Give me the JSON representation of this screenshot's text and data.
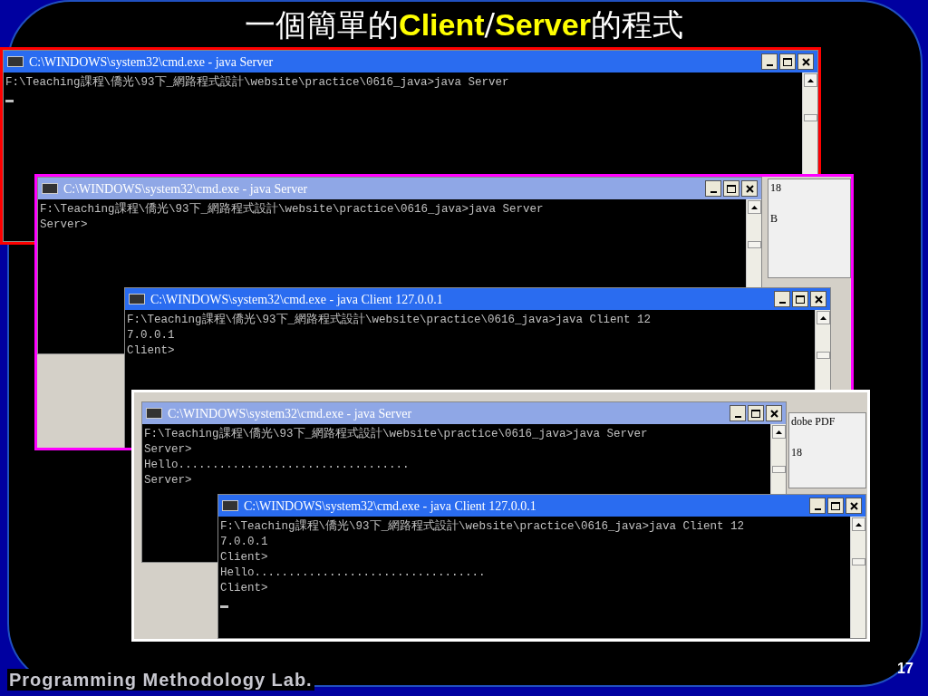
{
  "title_parts": [
    {
      "text": "一個簡單的",
      "kind": "plain"
    },
    {
      "text": "Client",
      "kind": "emph"
    },
    {
      "text": "/",
      "kind": "plain"
    },
    {
      "text": "Server",
      "kind": "emph"
    },
    {
      "text": "的程式",
      "kind": "plain"
    }
  ],
  "screenshots": [
    {
      "color": "#ff0000",
      "windows": [
        {
          "title": "C:\\WINDOWS\\system32\\cmd.exe - java Server",
          "active": true,
          "lines": [
            "F:\\Teaching課程\\僑光\\93下_網路程式設計\\website\\practice\\0616_java>java Server"
          ],
          "cursor": true
        }
      ]
    },
    {
      "color": "#ff00ff",
      "fragments": [
        "18",
        "B"
      ],
      "windows": [
        {
          "title": "C:\\WINDOWS\\system32\\cmd.exe - java Server",
          "active": false,
          "lines": [
            "F:\\Teaching課程\\僑光\\93下_網路程式設計\\website\\practice\\0616_java>java Server",
            "Server>"
          ],
          "cursor": false
        },
        {
          "title": "C:\\WINDOWS\\system32\\cmd.exe - java Client 127.0.0.1",
          "active": true,
          "lines": [
            "F:\\Teaching課程\\僑光\\93下_網路程式設計\\website\\practice\\0616_java>java Client 12",
            "7.0.0.1",
            "Client>"
          ],
          "cursor": false
        }
      ]
    },
    {
      "color": "#ffffff",
      "fragments": [
        "dobe PDF",
        "18"
      ],
      "windows": [
        {
          "title": "C:\\WINDOWS\\system32\\cmd.exe - java Server",
          "active": false,
          "lines": [
            "F:\\Teaching課程\\僑光\\93下_網路程式設計\\website\\practice\\0616_java>java Server",
            "Server>",
            "Hello..................................",
            "Server>"
          ],
          "cursor": false
        },
        {
          "title": "C:\\WINDOWS\\system32\\cmd.exe - java Client 127.0.0.1",
          "active": true,
          "lines": [
            "F:\\Teaching課程\\僑光\\93下_網路程式設計\\website\\practice\\0616_java>java Client 12",
            "7.0.0.1",
            "Client>",
            "Hello..................................",
            "Client>"
          ],
          "cursor": true
        }
      ]
    }
  ],
  "footer": "Programming Methodology Lab.",
  "page_number": "17"
}
